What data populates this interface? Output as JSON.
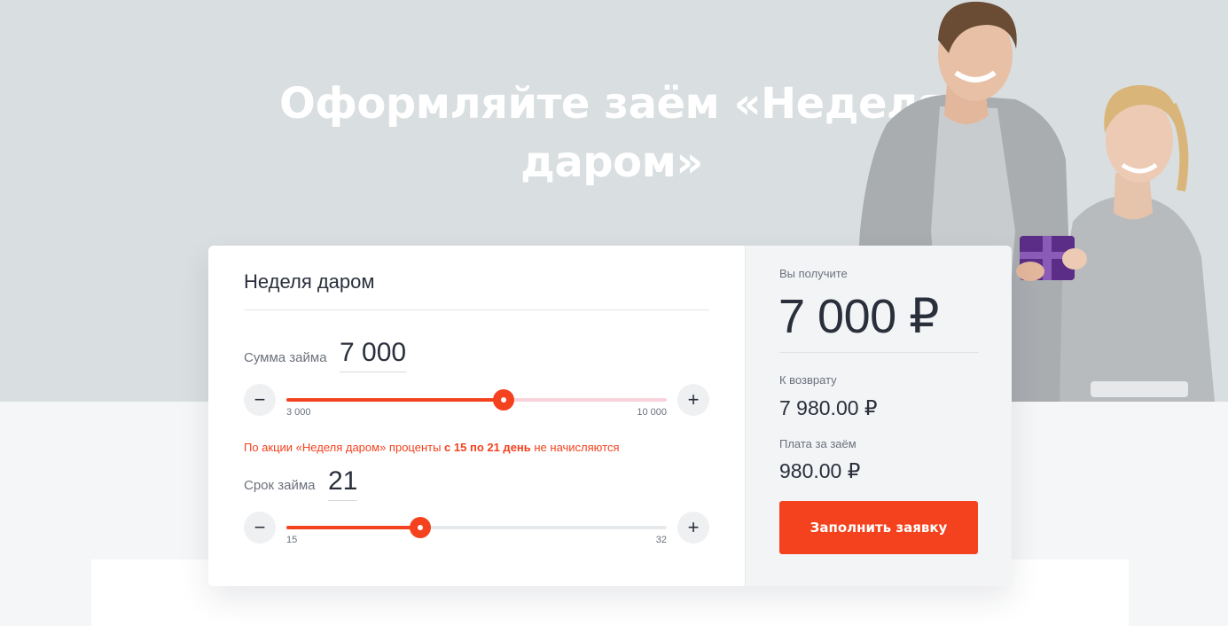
{
  "hero": {
    "title_line1": "Оформляйте заём «Неделя",
    "title_line2": "даром»"
  },
  "calculator": {
    "product_title": "Неделя даром",
    "amount": {
      "label": "Сумма займа",
      "value": "7 000",
      "min_label": "3 000",
      "max_label": "10 000",
      "minus": "−",
      "plus": "+",
      "level": 0.571
    },
    "promo": {
      "text_before": "По акции «Неделя даром» проценты ",
      "highlight": "с 15 по 21 день",
      "text_after": " не начисляются"
    },
    "term": {
      "label": "Срок займа",
      "value": "21",
      "min_label": "15",
      "max_label": "32",
      "minus": "−",
      "plus": "+",
      "level": 0.353
    }
  },
  "summary": {
    "receive_label": "Вы получите",
    "receive_value": "7 000 ₽",
    "return_label": "К возврату",
    "return_value": "7 980.00 ₽",
    "fee_label": "Плата за заём",
    "fee_value": "980.00 ₽",
    "cta_label": "Заполнить заявку"
  },
  "colors": {
    "accent": "#f4421e",
    "hero_bg": "#d9dee0",
    "text": "#2a2f3c",
    "muted": "#6b717c"
  }
}
